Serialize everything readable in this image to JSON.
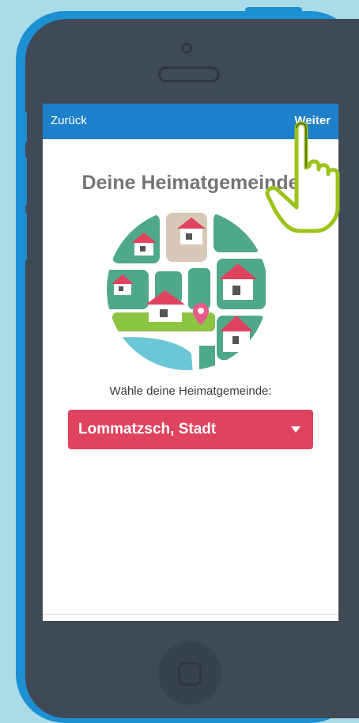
{
  "navbar": {
    "back_label": "Zurück",
    "next_label": "Weiter"
  },
  "title": "Deine Heimatgemeinde",
  "caption": "Wähle deine Heimatgemeinde:",
  "select": {
    "value": "Lommatzsch, Stadt"
  },
  "colors": {
    "background": "#a9dbe8",
    "phone_frame": "#1d8fd3",
    "phone_body": "#3f4a56",
    "navbar": "#1e7fcb",
    "select": "#e0435f",
    "hand_outline": "#9cc31a"
  }
}
